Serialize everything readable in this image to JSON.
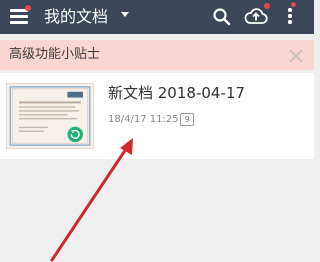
{
  "header": {
    "title": "我的文档",
    "menu_icon": "hamburger-icon",
    "dropdown_icon": "caret-down-icon",
    "search_icon": "search-icon",
    "upload_icon": "cloud-upload-icon",
    "more_icon": "more-vertical-icon",
    "notification_color": "#e8474a",
    "background": "#3b4658"
  },
  "banner": {
    "text": "高级功能小贴士",
    "close_icon": "close-icon",
    "background": "#fbd5d2"
  },
  "documents": [
    {
      "name": "新文档 2018-04-17",
      "date": "18/4/17 11:25",
      "page_count": "9"
    }
  ],
  "annotation": {
    "arrow_color": "#cc2a2a"
  }
}
